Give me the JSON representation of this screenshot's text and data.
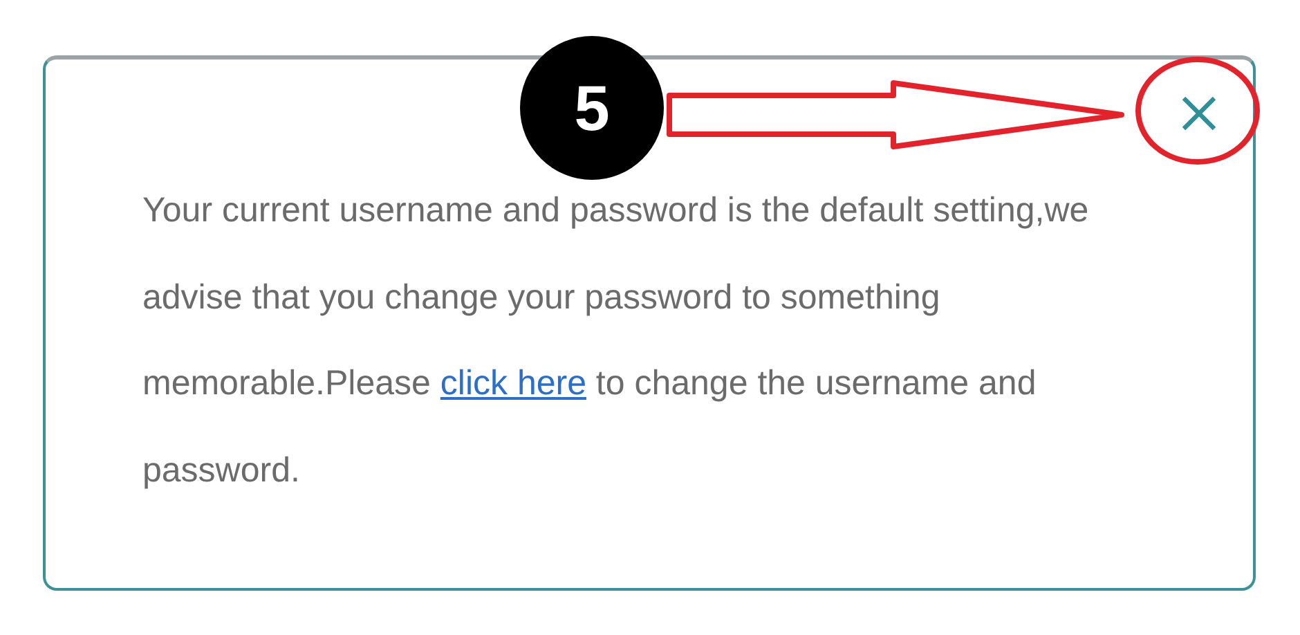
{
  "dialog": {
    "message": {
      "before": "Your current username and password is the default setting,we advise that you change your password to something memorable.Please ",
      "link": "click here",
      "after": " to change the username and password."
    }
  },
  "annotation": {
    "step": "5"
  }
}
